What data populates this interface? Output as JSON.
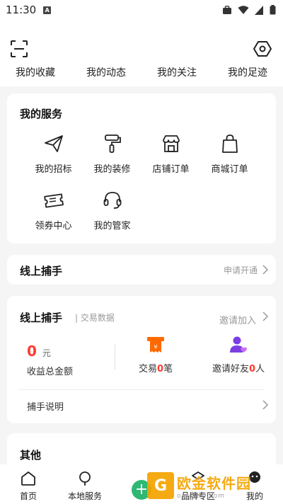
{
  "status_bar": {
    "time": "11:30",
    "app_badge": "A"
  },
  "header": {
    "quick_links": [
      "我的收藏",
      "我的动态",
      "我的关注",
      "我的足迹"
    ]
  },
  "services": {
    "title": "我的服务",
    "items": [
      {
        "label": "我的招标",
        "icon": "paper-plane-icon"
      },
      {
        "label": "我的装修",
        "icon": "paint-roller-icon"
      },
      {
        "label": "店铺订单",
        "icon": "shop-icon"
      },
      {
        "label": "商城订单",
        "icon": "shopping-bag-icon"
      },
      {
        "label": "领券中心",
        "icon": "coupon-icon"
      },
      {
        "label": "我的管家",
        "icon": "headset-icon"
      }
    ]
  },
  "catcher_bar": {
    "title": "线上捕手",
    "action": "申请开通"
  },
  "catcher_data": {
    "title": "线上捕手",
    "subtitle": "| 交易数据",
    "action": "邀请加入",
    "earnings": {
      "amount": "0",
      "unit": "元",
      "label": "收益总金额"
    },
    "trades": {
      "prefix": "交易",
      "count": "0",
      "suffix": "笔"
    },
    "invites": {
      "prefix": "邀请好友",
      "count": "0",
      "suffix": "人"
    },
    "howto": "捕手说明"
  },
  "other": {
    "title": "其他"
  },
  "tabbar": {
    "items": [
      {
        "label": "首页",
        "icon": "home-icon"
      },
      {
        "label": "本地服务",
        "icon": "location-pin-icon"
      },
      {
        "label": "",
        "icon": "plus-icon"
      },
      {
        "label": "品牌专区",
        "icon": "brand-icon"
      },
      {
        "label": "我的",
        "icon": "profile-icon"
      }
    ]
  },
  "watermark": {
    "text": "欧金软件园",
    "url": "oujinwb.com"
  },
  "colors": {
    "accent_red": "#ff3b30",
    "accent_orange": "#ff6a00",
    "accent_purple": "#7b3fe4",
    "plus_green": "#2eb872"
  }
}
